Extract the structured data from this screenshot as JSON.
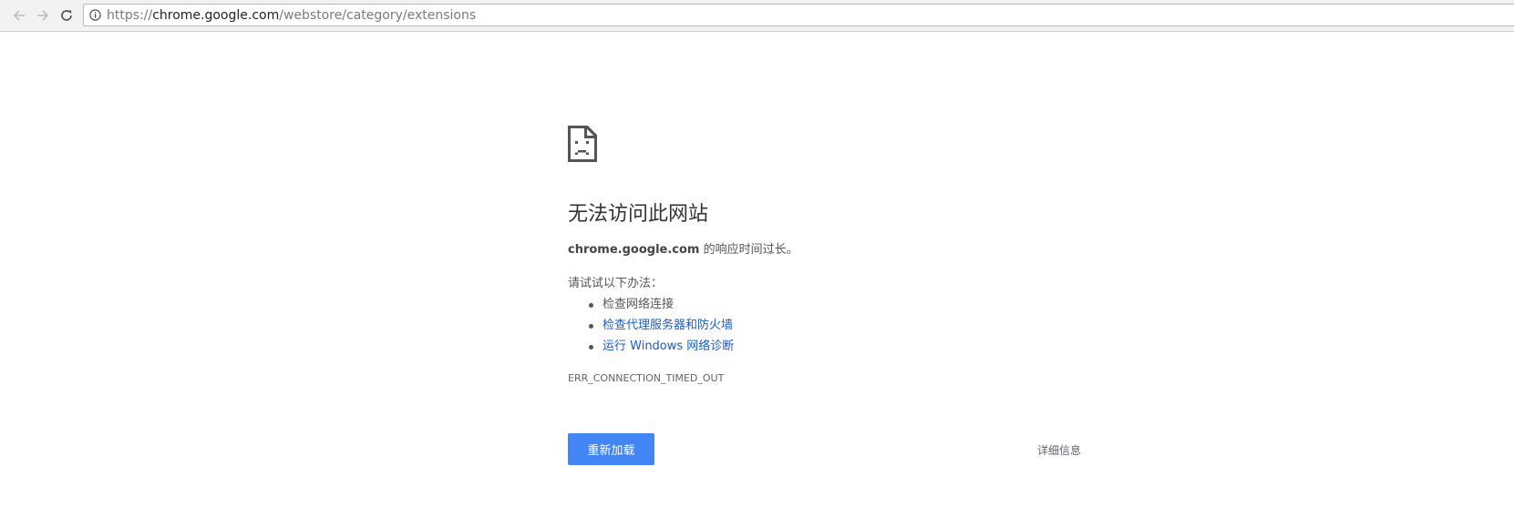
{
  "browser": {
    "url": {
      "scheme": "https://",
      "host": "chrome.google.com",
      "path": "/webstore/category/extensions"
    },
    "icons": {
      "back": "arrow-left-icon",
      "forward": "arrow-right-icon",
      "reload": "reload-icon",
      "site_info": "info-icon"
    }
  },
  "error_page": {
    "icon": "sad-page-icon",
    "heading": "无法访问此网站",
    "summary_host": "chrome.google.com",
    "summary_text": " 的响应时间过长。",
    "suggestions_label": "请试试以下办法：",
    "suggestions": [
      {
        "label": "检查网络连接",
        "is_link": false
      },
      {
        "label": "检查代理服务器和防火墙",
        "is_link": true
      },
      {
        "label": "运行 Windows 网络诊断",
        "is_link": true
      }
    ],
    "error_code": "ERR_CONNECTION_TIMED_OUT",
    "reload_button": "重新加载",
    "details_button": "详细信息",
    "colors": {
      "primary_button": "#4285f4",
      "link": "#1a5ccf"
    }
  }
}
